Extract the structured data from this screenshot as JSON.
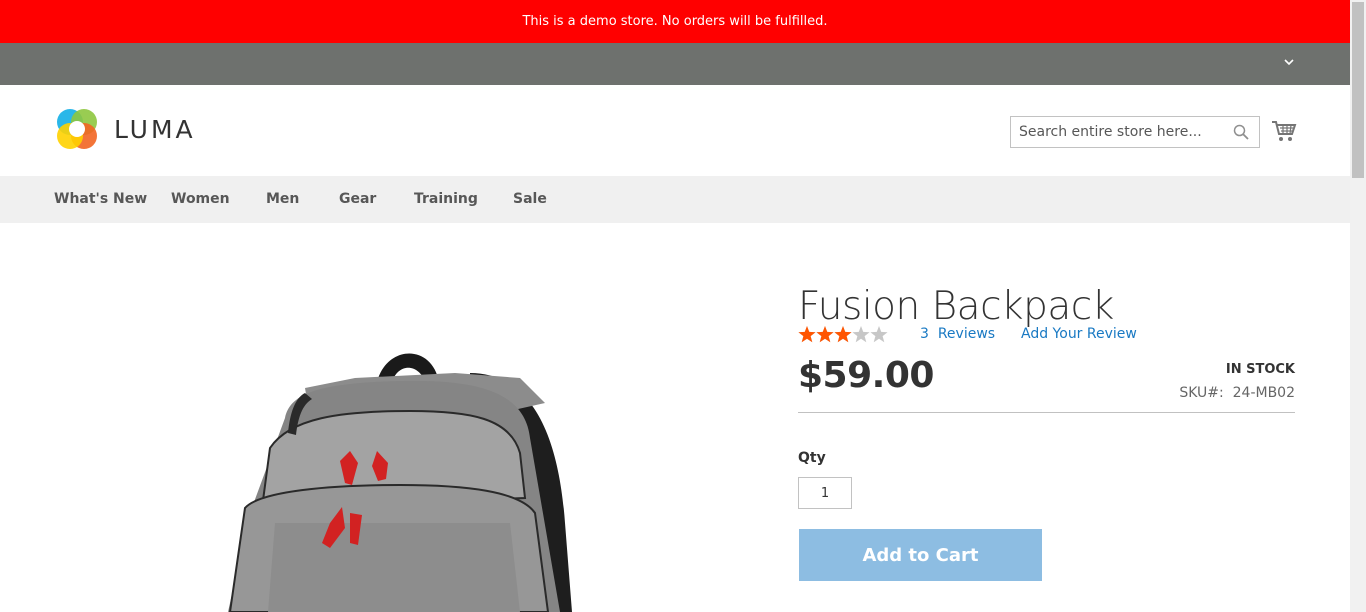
{
  "demo_notice": "This is a demo store. No orders will be fulfilled.",
  "header": {
    "logo_text": "LUMA",
    "search_placeholder": "Search entire store here...",
    "cart_icon": "shopping-cart-icon"
  },
  "nav": {
    "items": [
      {
        "label": "What's New"
      },
      {
        "label": "Women"
      },
      {
        "label": "Men"
      },
      {
        "label": "Gear"
      },
      {
        "label": "Training"
      },
      {
        "label": "Sale"
      }
    ]
  },
  "product": {
    "title": "Fusion Backpack",
    "rating_fraction": 0.6,
    "reviews_count": "3",
    "reviews_label": "Reviews",
    "add_review_label": "Add Your Review",
    "price": "$59.00",
    "stock_status": "IN STOCK",
    "sku_label": "SKU#:",
    "sku_value": "24-MB02",
    "qty_label": "Qty",
    "qty_value": "1",
    "add_to_cart_label": "Add to Cart"
  },
  "colors": {
    "demo_bar": "#ff0000",
    "panel_bar": "#6e716e",
    "nav_bg": "#f0f0f0",
    "link": "#1979c3",
    "star_filled": "#ff5501",
    "star_empty": "#c7c7c7",
    "add_to_cart_bg": "#8dbde2"
  }
}
